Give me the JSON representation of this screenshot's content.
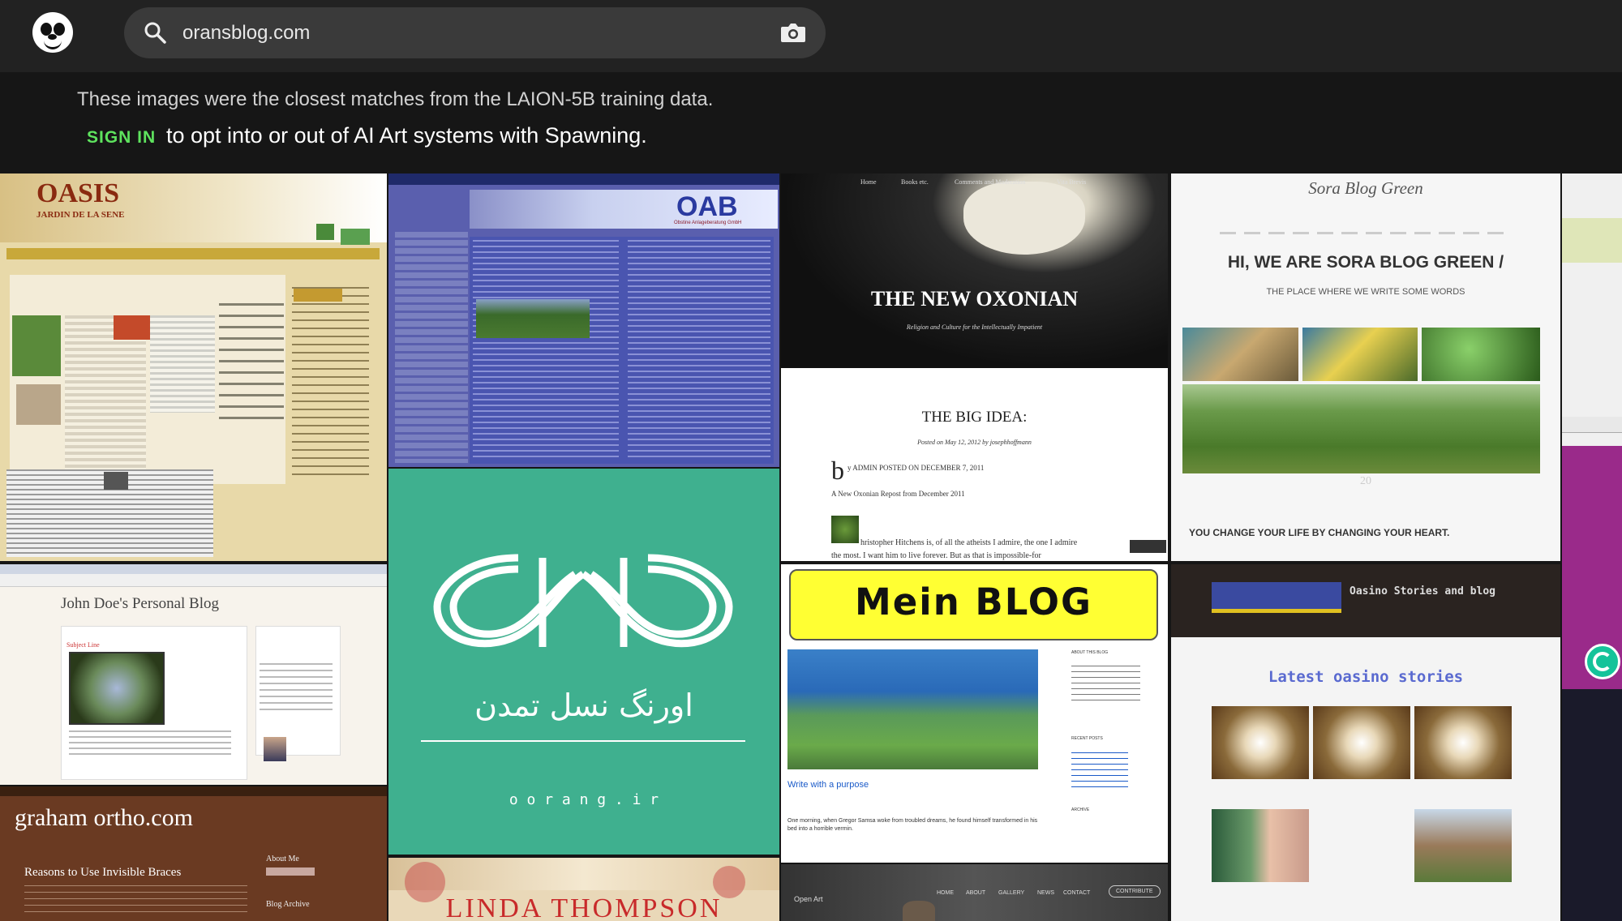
{
  "search": {
    "value": "oransblog.com",
    "placeholder": ""
  },
  "info": {
    "line1": "These images were the closest matches from the LAION-5B training data.",
    "sign_in": "SIGN IN",
    "opt_text": "to opt into or out of AI Art systems with Spawning."
  },
  "tiles": {
    "oasis": {
      "title": "OASIS",
      "subtitle": "JARDIN DE LA SENE"
    },
    "oab": {
      "logo": "OAB",
      "tagline": "Obstine Anlageberatung GmbH"
    },
    "oxonian": {
      "nav": [
        "Home",
        "Books etc.",
        "Comments and Moderation",
        "Vita Brevis"
      ],
      "title": "THE NEW OXONIAN",
      "subtitle": "Religion and Culture for the Intellectually Impatient",
      "post_title": "THE BIG IDEA:",
      "posted": "Posted on May 12, 2012 by josephhoffmann",
      "byline": "y ADMIN POSTED ON DECEMBER 7, 2011",
      "repost": "A New Oxonian Repost from December 2011",
      "text1": "hristopher Hitchens is, of all the atheists I admire, the one I admire",
      "text2": "the most. I want him to live forever. But as that is impossible-for"
    },
    "sora": {
      "logo": "Sora Blog Green",
      "headline": "HI, WE ARE SORA BLOG GREEN /",
      "sub": "THE PLACE WHERE WE WRITE SOME WORDS",
      "date": "20",
      "quote": "YOU CHANGE YOUR LIFE BY CHANGING YOUR HEART."
    },
    "johndoe": {
      "title": "John Doe's Personal Blog",
      "post": "Subject Line"
    },
    "orang": {
      "persian": "اورنگ نسل تمدن",
      "url": "o o r a n g . i r"
    },
    "mein": {
      "banner": "Mein BLOG",
      "post": "Write with a purpose",
      "text": "One morning, when Gregor Samsa woke from troubled dreams, he found himself transformed in his bed into a horrible vermin.",
      "side1": "ABOUT THIS BLOG",
      "side2": "RECENT POSTS",
      "side3": "ARCHIVE"
    },
    "oasino": {
      "header": "Oasino Stories and blog",
      "title": "Latest oasino stories"
    },
    "graham": {
      "title": "graham ortho.com",
      "post": "Reasons to Use Invisible Braces",
      "about": "About Me",
      "archive": "Blog Archive"
    },
    "linda": {
      "title": "LINDA THOMPSON"
    },
    "openart": {
      "brand": "Open Art",
      "nav": [
        "HOME",
        "ABOUT",
        "GALLERY",
        "NEWS",
        "CONTACT"
      ],
      "button": "CONTRIBUTE"
    }
  }
}
